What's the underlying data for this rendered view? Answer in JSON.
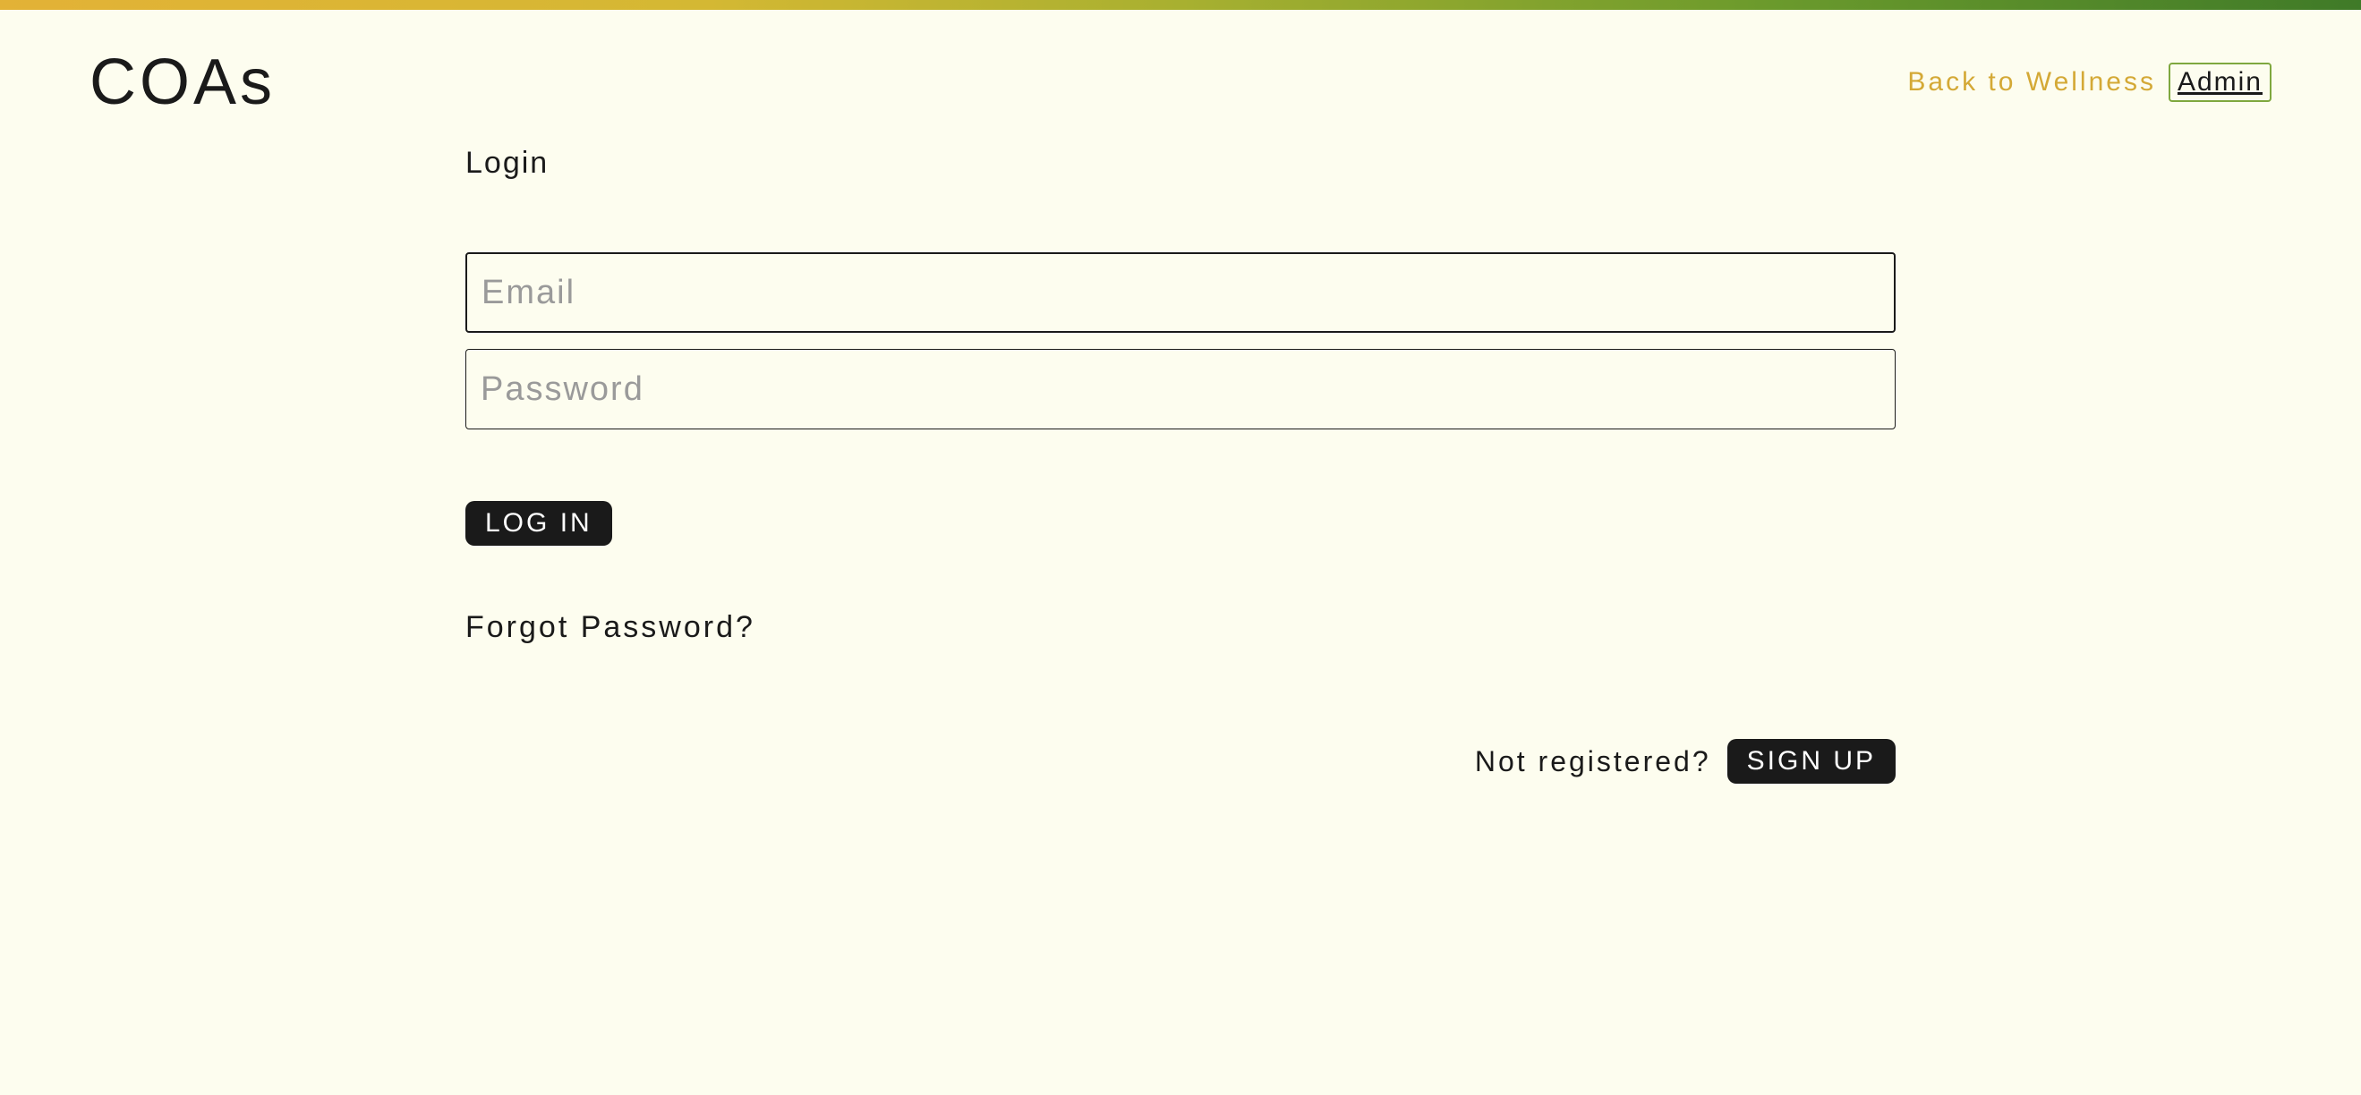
{
  "header": {
    "logo": "COAs",
    "back_to_wellness": "Back to Wellness",
    "admin": "Admin"
  },
  "form": {
    "heading": "Login",
    "email_placeholder": "Email",
    "password_placeholder": "Password",
    "login_button": "LOG IN",
    "forgot_password": "Forgot Password?",
    "not_registered": "Not registered?",
    "signup_button": "SIGN UP"
  }
}
